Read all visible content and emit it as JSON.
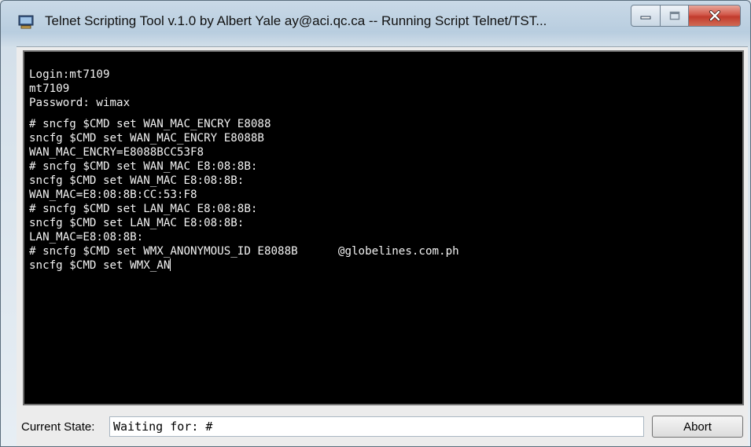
{
  "window": {
    "title": "Telnet Scripting Tool v.1.0 by Albert Yale ay@aci.qc.ca -- Running Script Telnet/TST...",
    "icon": "telnet-app-icon"
  },
  "caption_buttons": {
    "minimize_icon": "minimize-icon",
    "maximize_icon": "maximize-icon",
    "close_icon": "close-icon"
  },
  "terminal": {
    "lines": [
      "Login:mt7109",
      "mt7109",
      "Password: wimax",
      "",
      "# sncfg $CMD set WAN_MAC_ENCRY E8088",
      "sncfg $CMD set WAN_MAC_ENCRY E8088B",
      "WAN_MAC_ENCRY=E8088BCC53F8",
      "# sncfg $CMD set WAN_MAC E8:08:8B:",
      "sncfg $CMD set WAN_MAC E8:08:8B:",
      "WAN_MAC=E8:08:8B:CC:53:F8",
      "# sncfg $CMD set LAN_MAC E8:08:8B:",
      "sncfg $CMD set LAN_MAC E8:08:8B:",
      "LAN_MAC=E8:08:8B:",
      "# sncfg $CMD set WMX_ANONYMOUS_ID E8088B",
      "sncfg $CMD set WMX_AN"
    ],
    "line13_suffix": "@globelines.com.ph",
    "background": "#000000",
    "text_color": "#f2f2f2"
  },
  "status": {
    "label": "Current State:",
    "value": "Waiting for: #",
    "abort_label": "Abort"
  }
}
